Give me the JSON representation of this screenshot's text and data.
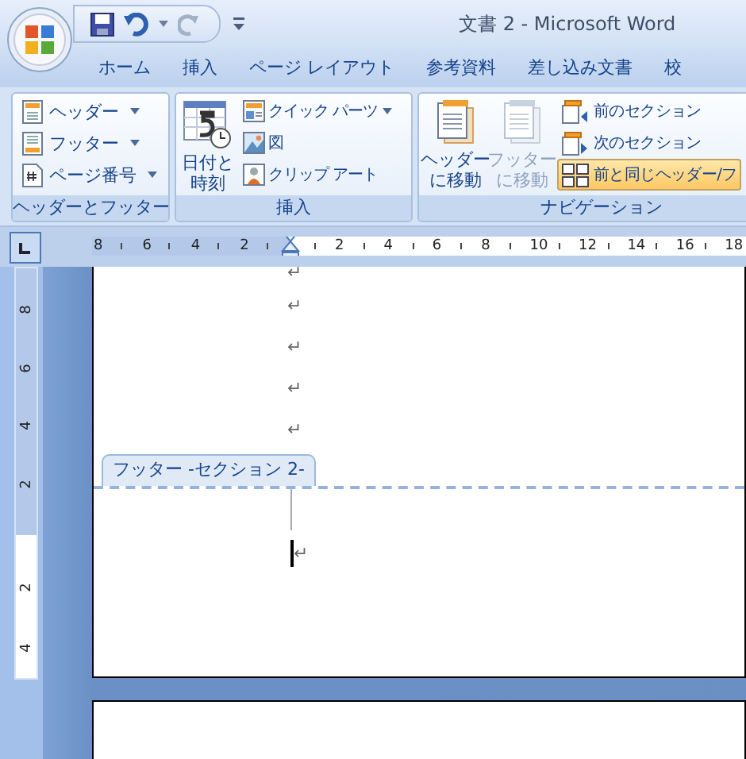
{
  "window": {
    "title": "文書 2 - Microsoft Word"
  },
  "tabs": [
    {
      "label": "ホーム",
      "selected": false
    },
    {
      "label": "挿入",
      "selected": false
    },
    {
      "label": "ページ レイアウト",
      "selected": false
    },
    {
      "label": "参考資料",
      "selected": false
    },
    {
      "label": "差し込み文書",
      "selected": false
    },
    {
      "label": "校",
      "selected": false
    }
  ],
  "ribbon": {
    "groups": [
      {
        "label": "ヘッダーとフッター",
        "items": [
          {
            "label": "ヘッダー",
            "dropdown": true
          },
          {
            "label": "フッター",
            "dropdown": true
          },
          {
            "label": "ページ番号",
            "dropdown": true
          }
        ]
      },
      {
        "label": "挿入",
        "items": [
          {
            "label": "日付と時刻"
          },
          {
            "label": "クイック パーツ",
            "dropdown": true
          },
          {
            "label": "図",
            "dropdown": false
          },
          {
            "label": "クリップ アート",
            "dropdown": false
          }
        ]
      },
      {
        "label": "ナビゲーション",
        "items": [
          {
            "label": "ヘッダーに移動",
            "disabled": false
          },
          {
            "label": "フッターに移動",
            "disabled": true
          },
          {
            "label": "前のセクション",
            "selected": false
          },
          {
            "label": "次のセクション",
            "selected": false
          },
          {
            "label": "前と同じヘッダー/フ",
            "selected": true
          }
        ]
      }
    ]
  },
  "ruler": {
    "left_numbers": [
      "8",
      "6",
      "4",
      "2"
    ],
    "right_numbers": [
      "2",
      "4",
      "6",
      "8",
      "10",
      "12",
      "14",
      "16",
      "18"
    ]
  },
  "vertical_ruler": {
    "top_numbers": [
      "8",
      "6",
      "4",
      "2"
    ],
    "bottom_numbers": [
      "2",
      "4"
    ]
  },
  "document": {
    "paragraph_marks": [
      "↵",
      "↵",
      "↵",
      "↵",
      "↵"
    ],
    "footer_tab": "フッター -セクション 2-",
    "footer_marks": [
      "↵"
    ]
  }
}
